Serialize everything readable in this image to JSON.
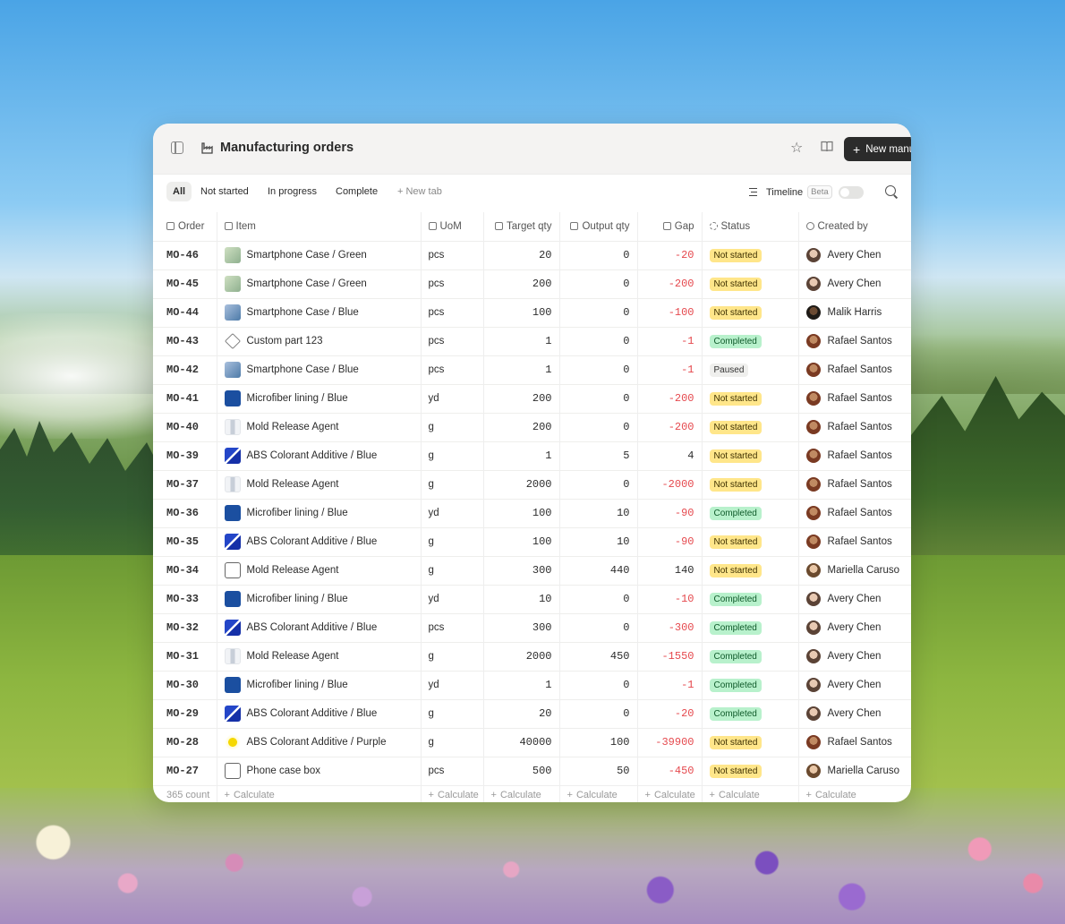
{
  "window": {
    "title": "Manufacturing orders",
    "new_button": "New manufacturing order"
  },
  "tabs": [
    "All",
    "Not started",
    "In progress",
    "Complete"
  ],
  "new_tab": "New tab",
  "timeline": {
    "label": "Timeline",
    "badge": "Beta"
  },
  "columns": [
    "Order",
    "Item",
    "UoM",
    "Target qty",
    "Output qty",
    "Gap",
    "Status",
    "Created by"
  ],
  "rows": [
    {
      "order": "MO-46",
      "item": "Smartphone Case / Green",
      "thumb": "green",
      "uom": "pcs",
      "target": "20",
      "output": "0",
      "gap": "-20",
      "status": "Not started",
      "creator": "Avery Chen",
      "av": "avery"
    },
    {
      "order": "MO-45",
      "item": "Smartphone Case / Green",
      "thumb": "green",
      "uom": "pcs",
      "target": "200",
      "output": "0",
      "gap": "-200",
      "status": "Not started",
      "creator": "Avery Chen",
      "av": "avery"
    },
    {
      "order": "MO-44",
      "item": "Smartphone Case / Blue",
      "thumb": "blue-case",
      "uom": "pcs",
      "target": "100",
      "output": "0",
      "gap": "-100",
      "status": "Not started",
      "creator": "Malik Harris",
      "av": "malik"
    },
    {
      "order": "MO-43",
      "item": "Custom part 123",
      "thumb": "part",
      "uom": "pcs",
      "target": "1",
      "output": "0",
      "gap": "-1",
      "status": "Completed",
      "creator": "Rafael Santos",
      "av": "rafael"
    },
    {
      "order": "MO-42",
      "item": "Smartphone Case / Blue",
      "thumb": "blue-case",
      "uom": "pcs",
      "target": "1",
      "output": "0",
      "gap": "-1",
      "status": "Paused",
      "creator": "Rafael Santos",
      "av": "rafael"
    },
    {
      "order": "MO-41",
      "item": "Microfiber lining / Blue",
      "thumb": "fabric",
      "uom": "yd",
      "target": "200",
      "output": "0",
      "gap": "-200",
      "status": "Not started",
      "creator": "Rafael Santos",
      "av": "rafael"
    },
    {
      "order": "MO-40",
      "item": "Mold Release Agent",
      "thumb": "agent",
      "uom": "g",
      "target": "200",
      "output": "0",
      "gap": "-200",
      "status": "Not started",
      "creator": "Rafael Santos",
      "av": "rafael"
    },
    {
      "order": "MO-39",
      "item": "ABS Colorant Additive / Blue",
      "thumb": "colorant",
      "uom": "g",
      "target": "1",
      "output": "5",
      "gap": "4",
      "status": "Not started",
      "creator": "Rafael Santos",
      "av": "rafael"
    },
    {
      "order": "MO-37",
      "item": "Mold Release Agent",
      "thumb": "agent",
      "uom": "g",
      "target": "2000",
      "output": "0",
      "gap": "-2000",
      "status": "Not started",
      "creator": "Rafael Santos",
      "av": "rafael"
    },
    {
      "order": "MO-36",
      "item": "Microfiber lining / Blue",
      "thumb": "fabric",
      "uom": "yd",
      "target": "100",
      "output": "10",
      "gap": "-90",
      "status": "Completed",
      "creator": "Rafael Santos",
      "av": "rafael"
    },
    {
      "order": "MO-35",
      "item": "ABS Colorant Additive / Blue",
      "thumb": "colorant",
      "uom": "g",
      "target": "100",
      "output": "10",
      "gap": "-90",
      "status": "Not started",
      "creator": "Rafael Santos",
      "av": "rafael"
    },
    {
      "order": "MO-34",
      "item": "Mold Release Agent",
      "thumb": "box",
      "uom": "g",
      "target": "300",
      "output": "440",
      "gap": "140",
      "status": "Not started",
      "creator": "Mariella Caruso",
      "av": "mariella"
    },
    {
      "order": "MO-33",
      "item": "Microfiber lining / Blue",
      "thumb": "fabric",
      "uom": "yd",
      "target": "10",
      "output": "0",
      "gap": "-10",
      "status": "Completed",
      "creator": "Avery Chen",
      "av": "avery"
    },
    {
      "order": "MO-32",
      "item": "ABS Colorant Additive / Blue",
      "thumb": "colorant",
      "uom": "pcs",
      "target": "300",
      "output": "0",
      "gap": "-300",
      "status": "Completed",
      "creator": "Avery Chen",
      "av": "avery"
    },
    {
      "order": "MO-31",
      "item": "Mold Release Agent",
      "thumb": "agent",
      "uom": "g",
      "target": "2000",
      "output": "450",
      "gap": "-1550",
      "status": "Completed",
      "creator": "Avery Chen",
      "av": "avery"
    },
    {
      "order": "MO-30",
      "item": "Microfiber lining / Blue",
      "thumb": "fabric",
      "uom": "yd",
      "target": "1",
      "output": "0",
      "gap": "-1",
      "status": "Completed",
      "creator": "Avery Chen",
      "av": "avery"
    },
    {
      "order": "MO-29",
      "item": "ABS Colorant Additive / Blue",
      "thumb": "colorant",
      "uom": "g",
      "target": "20",
      "output": "0",
      "gap": "-20",
      "status": "Completed",
      "creator": "Avery Chen",
      "av": "avery"
    },
    {
      "order": "MO-28",
      "item": "ABS Colorant Additive / Purple",
      "thumb": "purple",
      "uom": "g",
      "target": "40000",
      "output": "100",
      "gap": "-39900",
      "status": "Not started",
      "creator": "Rafael Santos",
      "av": "rafael"
    },
    {
      "order": "MO-27",
      "item": "Phone case box",
      "thumb": "box",
      "uom": "pcs",
      "target": "500",
      "output": "50",
      "gap": "-450",
      "status": "Not started",
      "creator": "Mariella Caruso",
      "av": "mariella"
    }
  ],
  "footer": {
    "count": "365 count",
    "calc": [
      "Calculate",
      "Calculate",
      "Calculate",
      "Calculate",
      "Calculate",
      "Calculate",
      "Calculate"
    ]
  },
  "colors": {
    "negative": "#e5484d",
    "not_started": "#ffe68a",
    "completed": "#b8f1cc",
    "paused": "#efefed"
  }
}
